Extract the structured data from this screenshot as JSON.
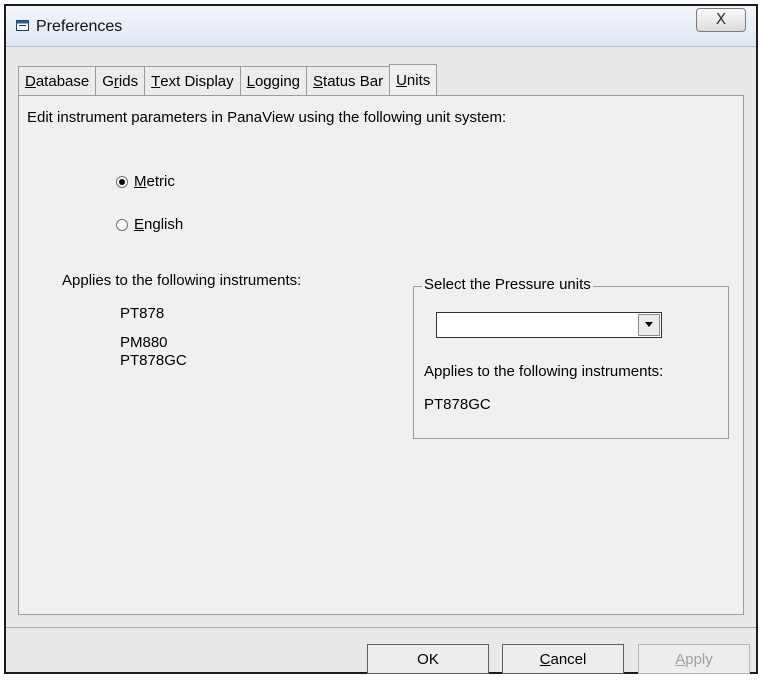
{
  "window": {
    "title": "Preferences",
    "close_symbol": "X"
  },
  "tabs": [
    {
      "pre": "",
      "u": "D",
      "post": "atabase",
      "active": false
    },
    {
      "pre": "G",
      "u": "r",
      "post": "ids",
      "active": false
    },
    {
      "pre": "",
      "u": "T",
      "post": "ext Display",
      "active": false
    },
    {
      "pre": "",
      "u": "L",
      "post": "ogging",
      "active": false
    },
    {
      "pre": "",
      "u": "S",
      "post": "tatus Bar",
      "active": false
    },
    {
      "pre": "",
      "u": "U",
      "post": "nits",
      "active": true
    }
  ],
  "units": {
    "instruction": "Edit instrument parameters in PanaView using the following unit system:",
    "options": [
      {
        "u": "M",
        "rest": "etric",
        "selected": true
      },
      {
        "u": "E",
        "rest": "nglish",
        "selected": false
      }
    ],
    "applies_label": "Applies to the following instruments:",
    "instruments": [
      "PT878",
      "PM880",
      "PT878GC"
    ]
  },
  "pressure": {
    "group_title": "Select the Pressure units",
    "selected_value": "",
    "applies_label": "Applies to the following instruments:",
    "instruments": [
      "PT878GC"
    ]
  },
  "buttons": {
    "ok": "OK",
    "cancel": {
      "u": "C",
      "rest": "ancel"
    },
    "apply": {
      "u": "A",
      "rest": "pply",
      "enabled": false
    }
  }
}
